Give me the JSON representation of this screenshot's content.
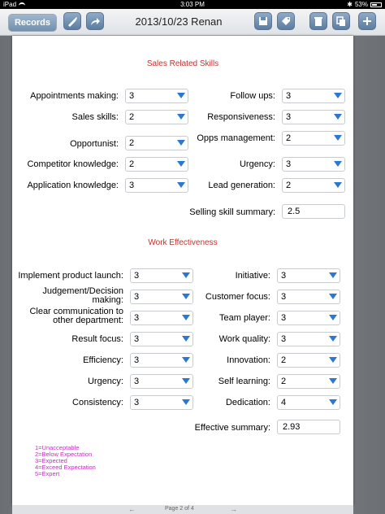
{
  "status": {
    "device": "iPad",
    "time": "3:03 PM",
    "battery": "53%"
  },
  "toolbar": {
    "records_label": "Records",
    "title": "2013/10/23 Renan"
  },
  "sales": {
    "title": "Sales Related Skills",
    "left": [
      {
        "label": "Appointments making:",
        "value": "3"
      },
      {
        "label": "Sales skills:",
        "value": "2"
      },
      {
        "label": "Opportunist:",
        "value": "2"
      },
      {
        "label": "Competitor knowledge:",
        "value": "2"
      },
      {
        "label": "Application knowledge:",
        "value": "3"
      }
    ],
    "right": [
      {
        "label": "Follow ups:",
        "value": "3"
      },
      {
        "label": "Responsiveness:",
        "value": "3"
      },
      {
        "label": "Opps management:",
        "value": "2"
      },
      {
        "label": "Urgency:",
        "value": "3"
      },
      {
        "label": "Lead generation:",
        "value": "2"
      }
    ],
    "summary_label": "Selling skill summary:",
    "summary_value": "2.5"
  },
  "work": {
    "title": "Work Effectiveness",
    "left": [
      {
        "label": "Implement product launch:",
        "value": "3"
      },
      {
        "label": "Judgement/Decision making:",
        "value": "3"
      },
      {
        "label": "Clear communication to other department:",
        "value": "3"
      },
      {
        "label": "Result focus:",
        "value": "3"
      },
      {
        "label": "Efficiency:",
        "value": "3"
      },
      {
        "label": "Urgency:",
        "value": "3"
      },
      {
        "label": "Consistency:",
        "value": "3"
      }
    ],
    "right": [
      {
        "label": "Initiative:",
        "value": "3"
      },
      {
        "label": "Customer focus:",
        "value": "3"
      },
      {
        "label": "Team player:",
        "value": "3"
      },
      {
        "label": "Work quality:",
        "value": "3"
      },
      {
        "label": "Innovation:",
        "value": "2"
      },
      {
        "label": "Self learning:",
        "value": "2"
      },
      {
        "label": "Dedication:",
        "value": "4"
      }
    ],
    "summary_label": "Effective summary:",
    "summary_value": "2.93"
  },
  "legend": [
    "1=Unacceptable",
    "2=Below Expectation",
    "3=Expected",
    "4=Exceed Expectation",
    "5=Expert"
  ],
  "footer": {
    "page": "Page 2 of 4"
  },
  "colors": {
    "section_title": "#c0332f",
    "legend": "#c030c0",
    "arrow": "#2a78d4"
  }
}
